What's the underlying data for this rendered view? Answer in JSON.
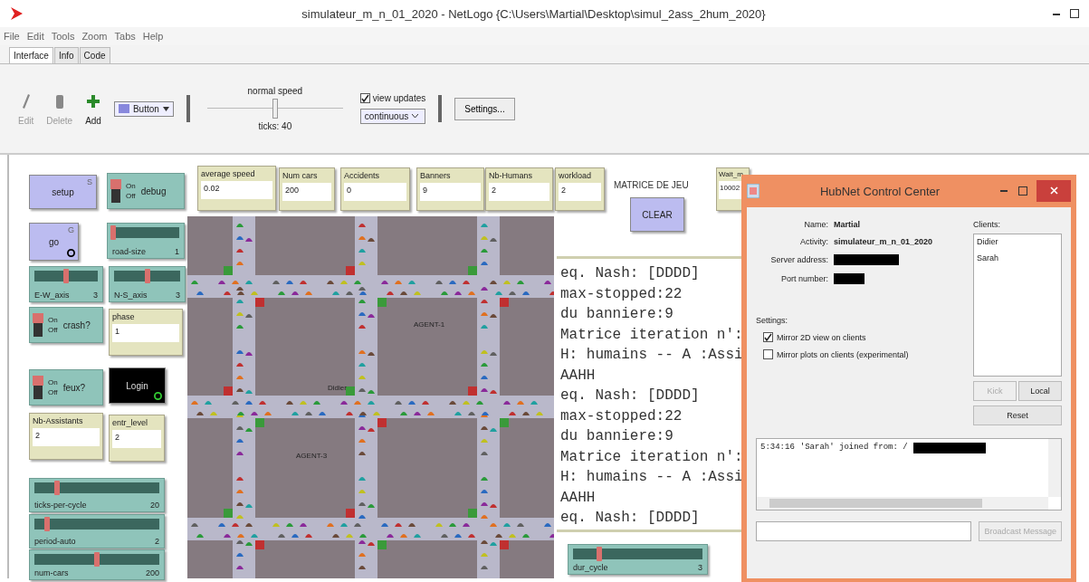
{
  "window": {
    "title": "simulateur_m_n_01_2020 - NetLogo {C:\\Users\\Martial\\Desktop\\simul_2ass_2hum_2020}"
  },
  "menu": [
    "File",
    "Edit",
    "Tools",
    "Zoom",
    "Tabs",
    "Help"
  ],
  "tabs": [
    {
      "label": "Interface",
      "selected": true
    },
    {
      "label": "Info",
      "selected": false
    },
    {
      "label": "Code",
      "selected": false
    }
  ],
  "toolbar": {
    "tools": [
      {
        "kind": "edit",
        "label": "Edit",
        "disabled": true
      },
      {
        "kind": "delete",
        "label": "Delete",
        "disabled": true
      },
      {
        "kind": "add",
        "label": "Add",
        "disabled": false
      }
    ],
    "widget_type": "Button",
    "speed": {
      "label": "normal speed",
      "level": 0.5,
      "ticks": "ticks: 40"
    },
    "view_updates": {
      "label": "view updates",
      "checked": true
    },
    "update_mode": "continuous",
    "settings": "Settings..."
  },
  "buttons": [
    {
      "label": "setup",
      "key": "S",
      "forever": false,
      "running": false
    },
    {
      "label": "go",
      "key": "G",
      "forever": true,
      "running": false
    },
    {
      "label": "CLEAR",
      "forever": false,
      "running": false
    },
    {
      "label": "Login",
      "forever": true,
      "running": true
    }
  ],
  "switches": [
    {
      "label": "debug",
      "on": true,
      "on_text": "On",
      "off_text": "Off"
    },
    {
      "label": "crash?",
      "on": true,
      "on_text": "On",
      "off_text": "Off"
    },
    {
      "label": "feux?",
      "on": true,
      "on_text": "On",
      "off_text": "Off"
    }
  ],
  "sliders": [
    {
      "label": "road-size",
      "value": "1",
      "level": 0.02
    },
    {
      "label": "E-W_axis",
      "value": "3",
      "level": 0.5
    },
    {
      "label": "N-S_axis",
      "value": "3",
      "level": 0.5
    },
    {
      "label": "ticks-per-cycle",
      "value": "20",
      "level": 0.18
    },
    {
      "label": "period-auto",
      "value": "2",
      "level": 0.1
    },
    {
      "label": "num-cars",
      "value": "200",
      "level": 0.5
    },
    {
      "label": "dur_cycle",
      "value": "3",
      "level": 0.2
    }
  ],
  "inputs": [
    {
      "label": "phase",
      "value": "1"
    },
    {
      "label": "Nb-Assistants",
      "value": "2"
    },
    {
      "label": "entr_level",
      "value": "2"
    }
  ],
  "monitors": [
    {
      "label": "average speed",
      "value": "0.02"
    },
    {
      "label": "Num cars",
      "value": "200"
    },
    {
      "label": "Accidents",
      "value": "0"
    },
    {
      "label": "Banners",
      "value": "9"
    },
    {
      "label": "Nb-Humans",
      "value": "2"
    },
    {
      "label": "workload",
      "value": "2"
    },
    {
      "label": "Wait_m",
      "value": "10002"
    }
  ],
  "note": "MATRICE DE JEU",
  "view": {
    "labels": [
      "AGENT-1",
      "Didier",
      "AGENT-3"
    ]
  },
  "output": {
    "lines": [
      "eq. Nash: [DDDD]",
      "max-stopped:22",
      "du banniere:9",
      "Matrice iteration n':",
      "H: humains -- A :Assi",
      "AAHH",
      "eq. Nash: [DDDD]",
      "max-stopped:22",
      "du banniere:9",
      "Matrice iteration n':",
      "H: humains -- A :Assi",
      "AAHH",
      "eq. Nash: [DDDD]"
    ]
  },
  "hubnet": {
    "title": "HubNet Control Center",
    "fields": [
      {
        "label": "Name:",
        "value": "Martial"
      },
      {
        "label": "Activity:",
        "value": "simulateur_m_n_01_2020"
      },
      {
        "label": "Server address:",
        "redacted": true
      },
      {
        "label": "Port number:",
        "redacted": true
      }
    ],
    "clients_label": "Clients:",
    "clients": [
      "Didier",
      "Sarah"
    ],
    "settings_label": "Settings:",
    "options": [
      {
        "label": "Mirror 2D view on clients",
        "checked": true
      },
      {
        "label": "Mirror plots on clients (experimental)",
        "checked": false
      }
    ],
    "buttons": [
      {
        "label": "Kick",
        "disabled": true
      },
      {
        "label": "Local",
        "disabled": false
      },
      {
        "label": "Reset",
        "disabled": false
      }
    ],
    "log": [
      {
        "time": "5:34:16",
        "text": "'Sarah' joined from: /",
        "redacted": true
      }
    ],
    "broadcast": {
      "label": "Broadcast Message",
      "disabled": true
    }
  }
}
